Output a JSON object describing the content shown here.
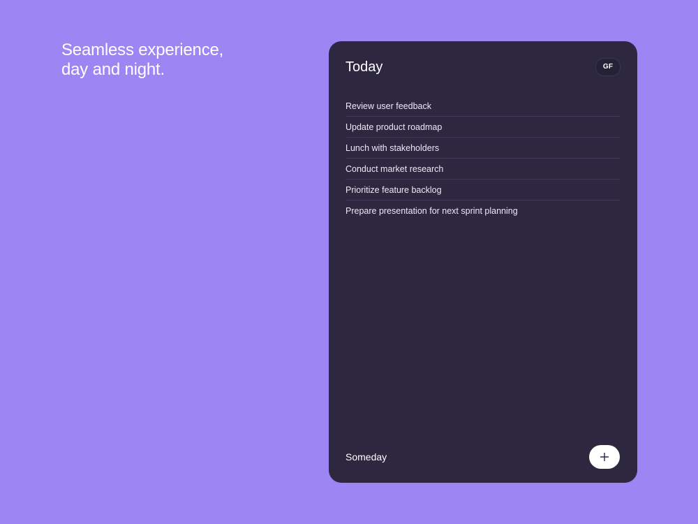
{
  "hero": {
    "line1": "Seamless experience,",
    "line2": "day and night."
  },
  "card": {
    "title": "Today",
    "avatar_initials": "GF",
    "tasks": [
      "Review user feedback",
      "Update product roadmap",
      "Lunch with stakeholders",
      "Conduct market research",
      "Prioritize feature backlog",
      "Prepare presentation for next sprint planning"
    ],
    "footer_label": "Someday",
    "add_icon": "plus-icon"
  },
  "colors": {
    "background": "#9d85f4",
    "card": "#2d2840",
    "text": "#ffffff",
    "divider": "#3f3a55"
  }
}
